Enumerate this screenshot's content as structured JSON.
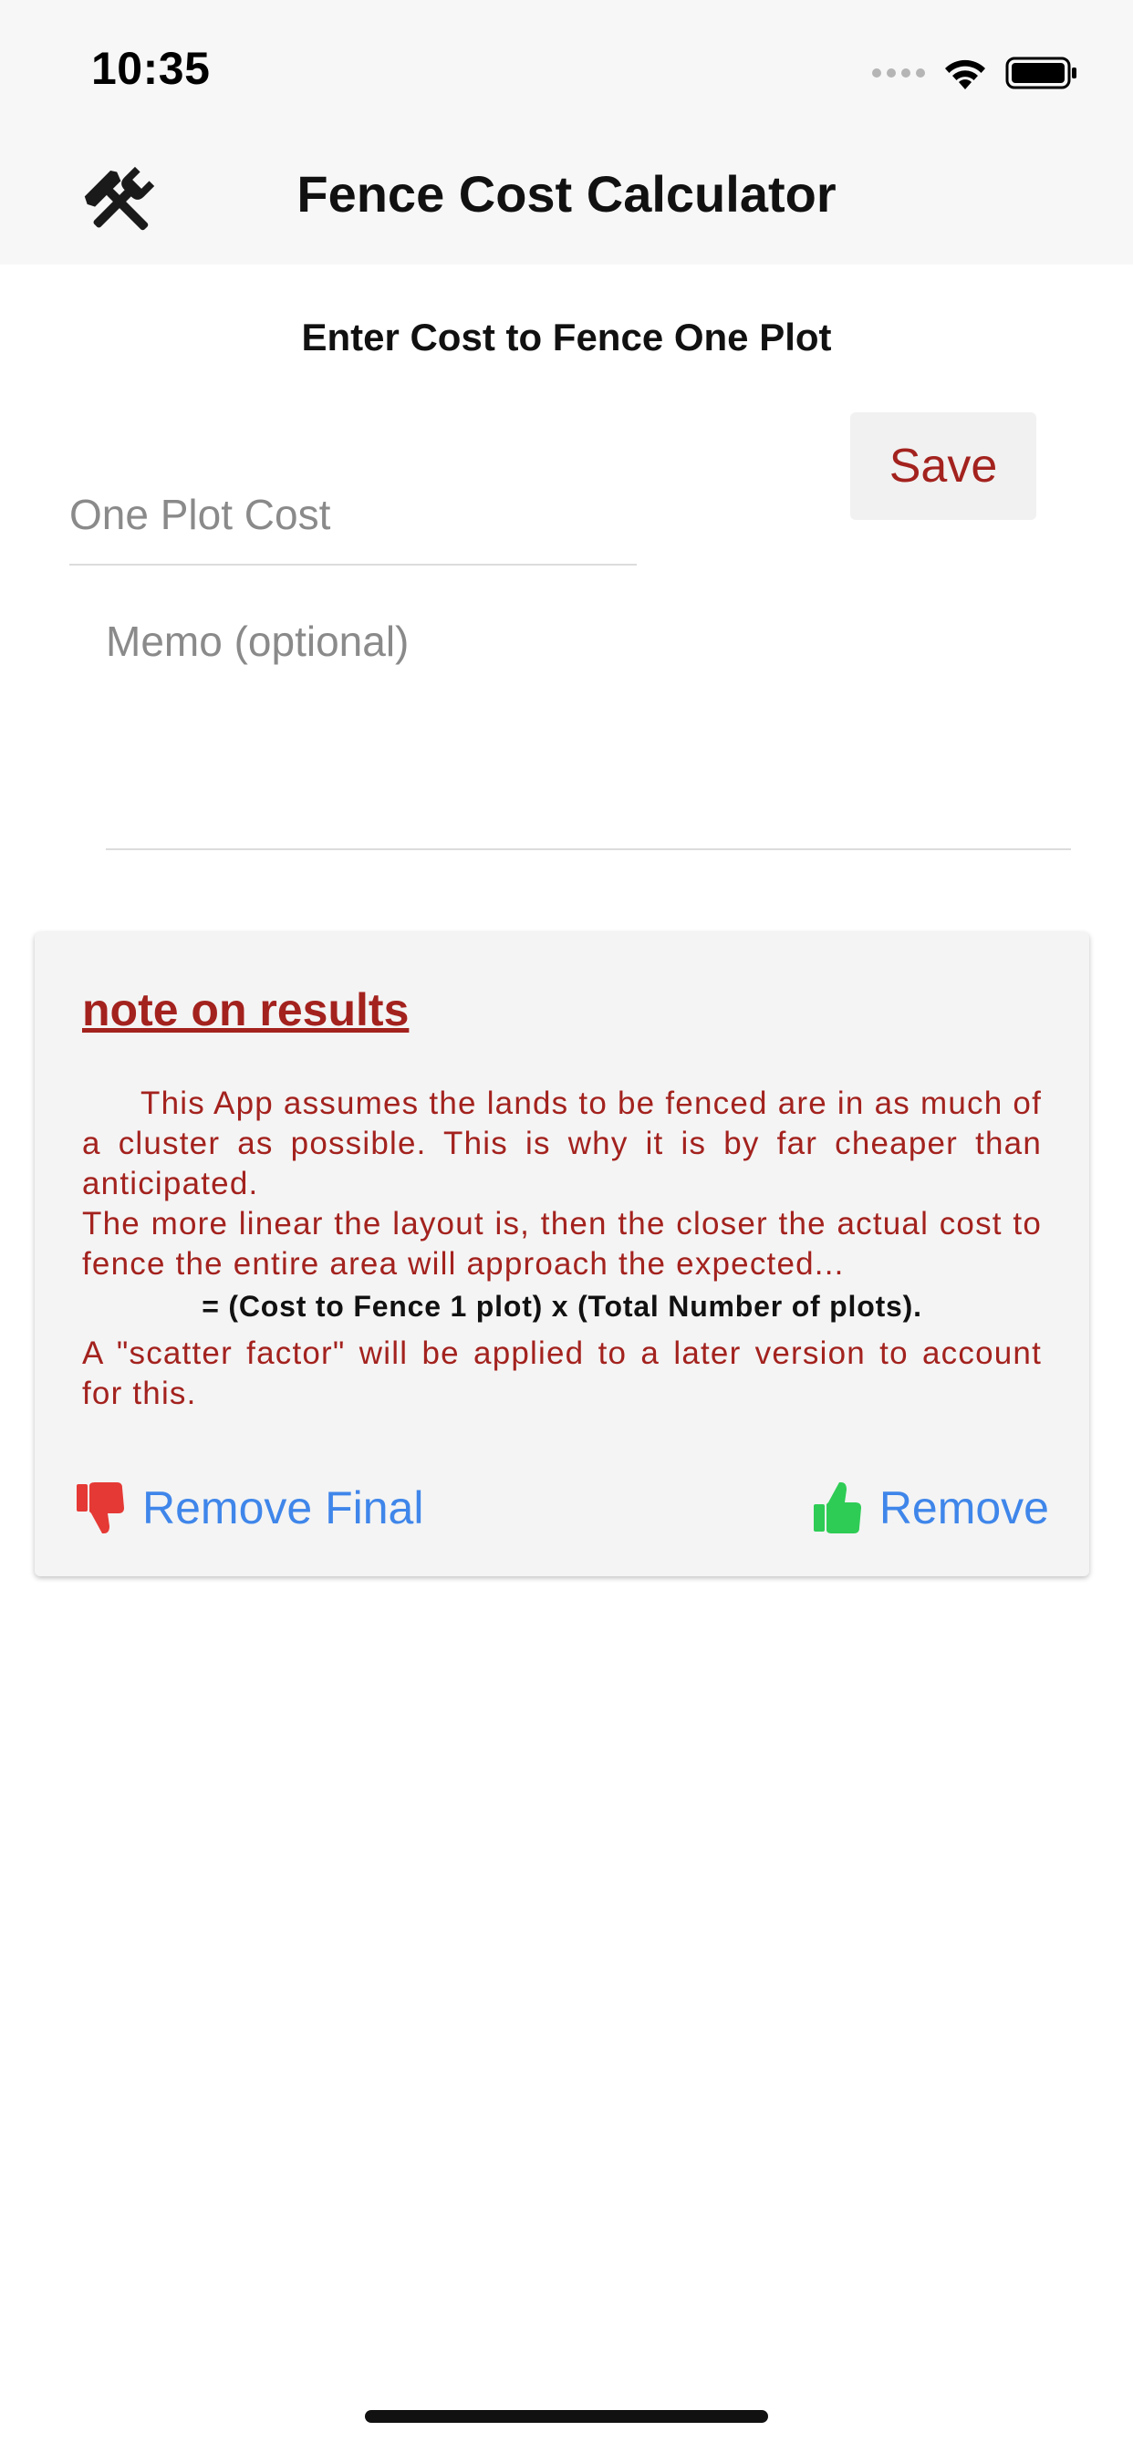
{
  "status_bar": {
    "time": "10:35"
  },
  "header": {
    "title": "Fence Cost Calculator",
    "icon": "tools-icon"
  },
  "form": {
    "section_title": "Enter Cost to Fence One Plot",
    "cost_placeholder": "One Plot Cost",
    "cost_value": "",
    "save_label": "Save",
    "memo_placeholder": "Memo (optional)",
    "memo_value": ""
  },
  "note": {
    "title": "note on results",
    "paragraph1": "This App assumes the lands to be fenced are in as much of a cluster as possible. This is why it is by far cheaper than anticipated.",
    "paragraph2": "The more linear the layout is, then the closer the actual cost to fence the entire area will approach the expected...",
    "formula": "= (Cost to Fence 1 plot) x (Total Number of plots).",
    "paragraph3": "A \"scatter factor\" will be applied to a later version to account for this.",
    "remove_final_label": "Remove Final",
    "remove_label": "Remove"
  },
  "colors": {
    "accent_red": "#a3221e",
    "link_blue": "#3f86ea",
    "thumb_down_red": "#e53935",
    "thumb_up_green": "#2ecc55"
  }
}
